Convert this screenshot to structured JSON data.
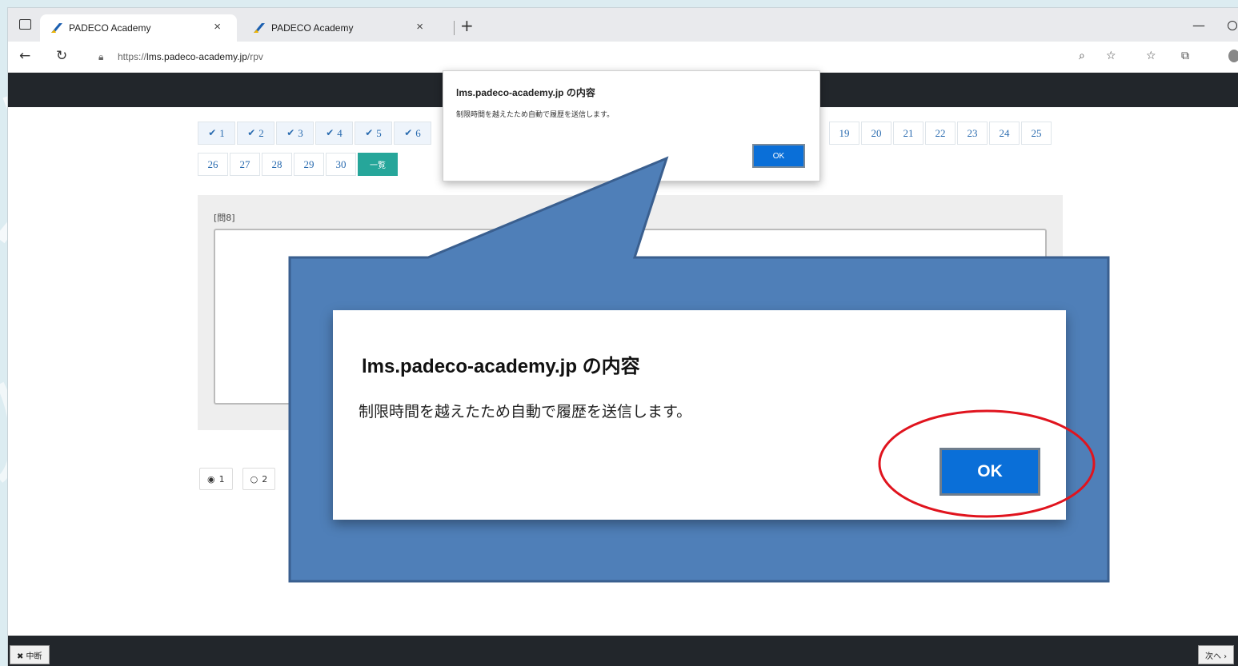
{
  "browser": {
    "tabs": [
      {
        "title": "PADECO Academy",
        "close": "×"
      },
      {
        "title": "PADECO Academy",
        "close": "×"
      }
    ],
    "new_tab": "+",
    "url_prefix": "https://",
    "url_host": "lms.padeco-academy.jp",
    "url_path": "/rpv"
  },
  "question_nav": {
    "row1": [
      {
        "label": "1",
        "checked": true
      },
      {
        "label": "2",
        "checked": true
      },
      {
        "label": "3",
        "checked": true
      },
      {
        "label": "4",
        "checked": true
      },
      {
        "label": "5",
        "checked": true
      },
      {
        "label": "6",
        "checked": true
      }
    ],
    "row1_right": [
      "19",
      "20",
      "21",
      "22",
      "23",
      "24",
      "25"
    ],
    "row2": [
      "26",
      "27",
      "28",
      "29",
      "30"
    ],
    "list_label": "一覧",
    "check_mark": "✔"
  },
  "question": {
    "label": "[問8]"
  },
  "answers": [
    {
      "label": "1",
      "selected": true,
      "mark": "◉"
    },
    {
      "label": "2",
      "selected": false,
      "mark": "○"
    }
  ],
  "footer": {
    "abort_label": "✖ 中断",
    "next_label": "次へ ›"
  },
  "small_dialog": {
    "title": "lms.padeco-academy.jp の内容",
    "message": "制限時間を越えたため自動で履歴を送信します。",
    "ok_label": "OK"
  },
  "zoom_dialog": {
    "title": "lms.padeco-academy.jp の内容",
    "message": "制限時間を越えたため自動で履歴を送信します。",
    "ok_label": "OK"
  },
  "colors": {
    "callout_fill": "#4f7fb8",
    "callout_stroke": "#3a5f8f",
    "highlight_ring": "#e0141e",
    "ok_blue": "#0a6fd8",
    "header_dark": "#22262b",
    "list_teal": "#26a69a"
  }
}
